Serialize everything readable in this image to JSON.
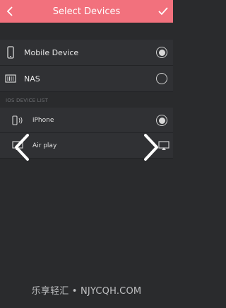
{
  "header": {
    "title": "Select Devices",
    "back_icon": "chevron-left-icon",
    "confirm_icon": "check-icon",
    "background": "#f2717d"
  },
  "devices": [
    {
      "label": "Mobile Device",
      "icon": "phone-icon",
      "selected": true
    },
    {
      "label": "NAS",
      "icon": "nas-icon",
      "selected": false
    }
  ],
  "ios_section": {
    "title": "IOS DEVICE LIST",
    "items": [
      {
        "label": "iPhone",
        "icon": "phone-speaker-icon",
        "selected": true
      },
      {
        "label": "Air play",
        "icon": "airplay-icon",
        "selected": false
      }
    ]
  },
  "carousel": {
    "prev_icon": "chevron-left-icon",
    "next_icon": "chevron-right-icon"
  },
  "watermark": "乐享轻汇 • NJYCQH.COM"
}
